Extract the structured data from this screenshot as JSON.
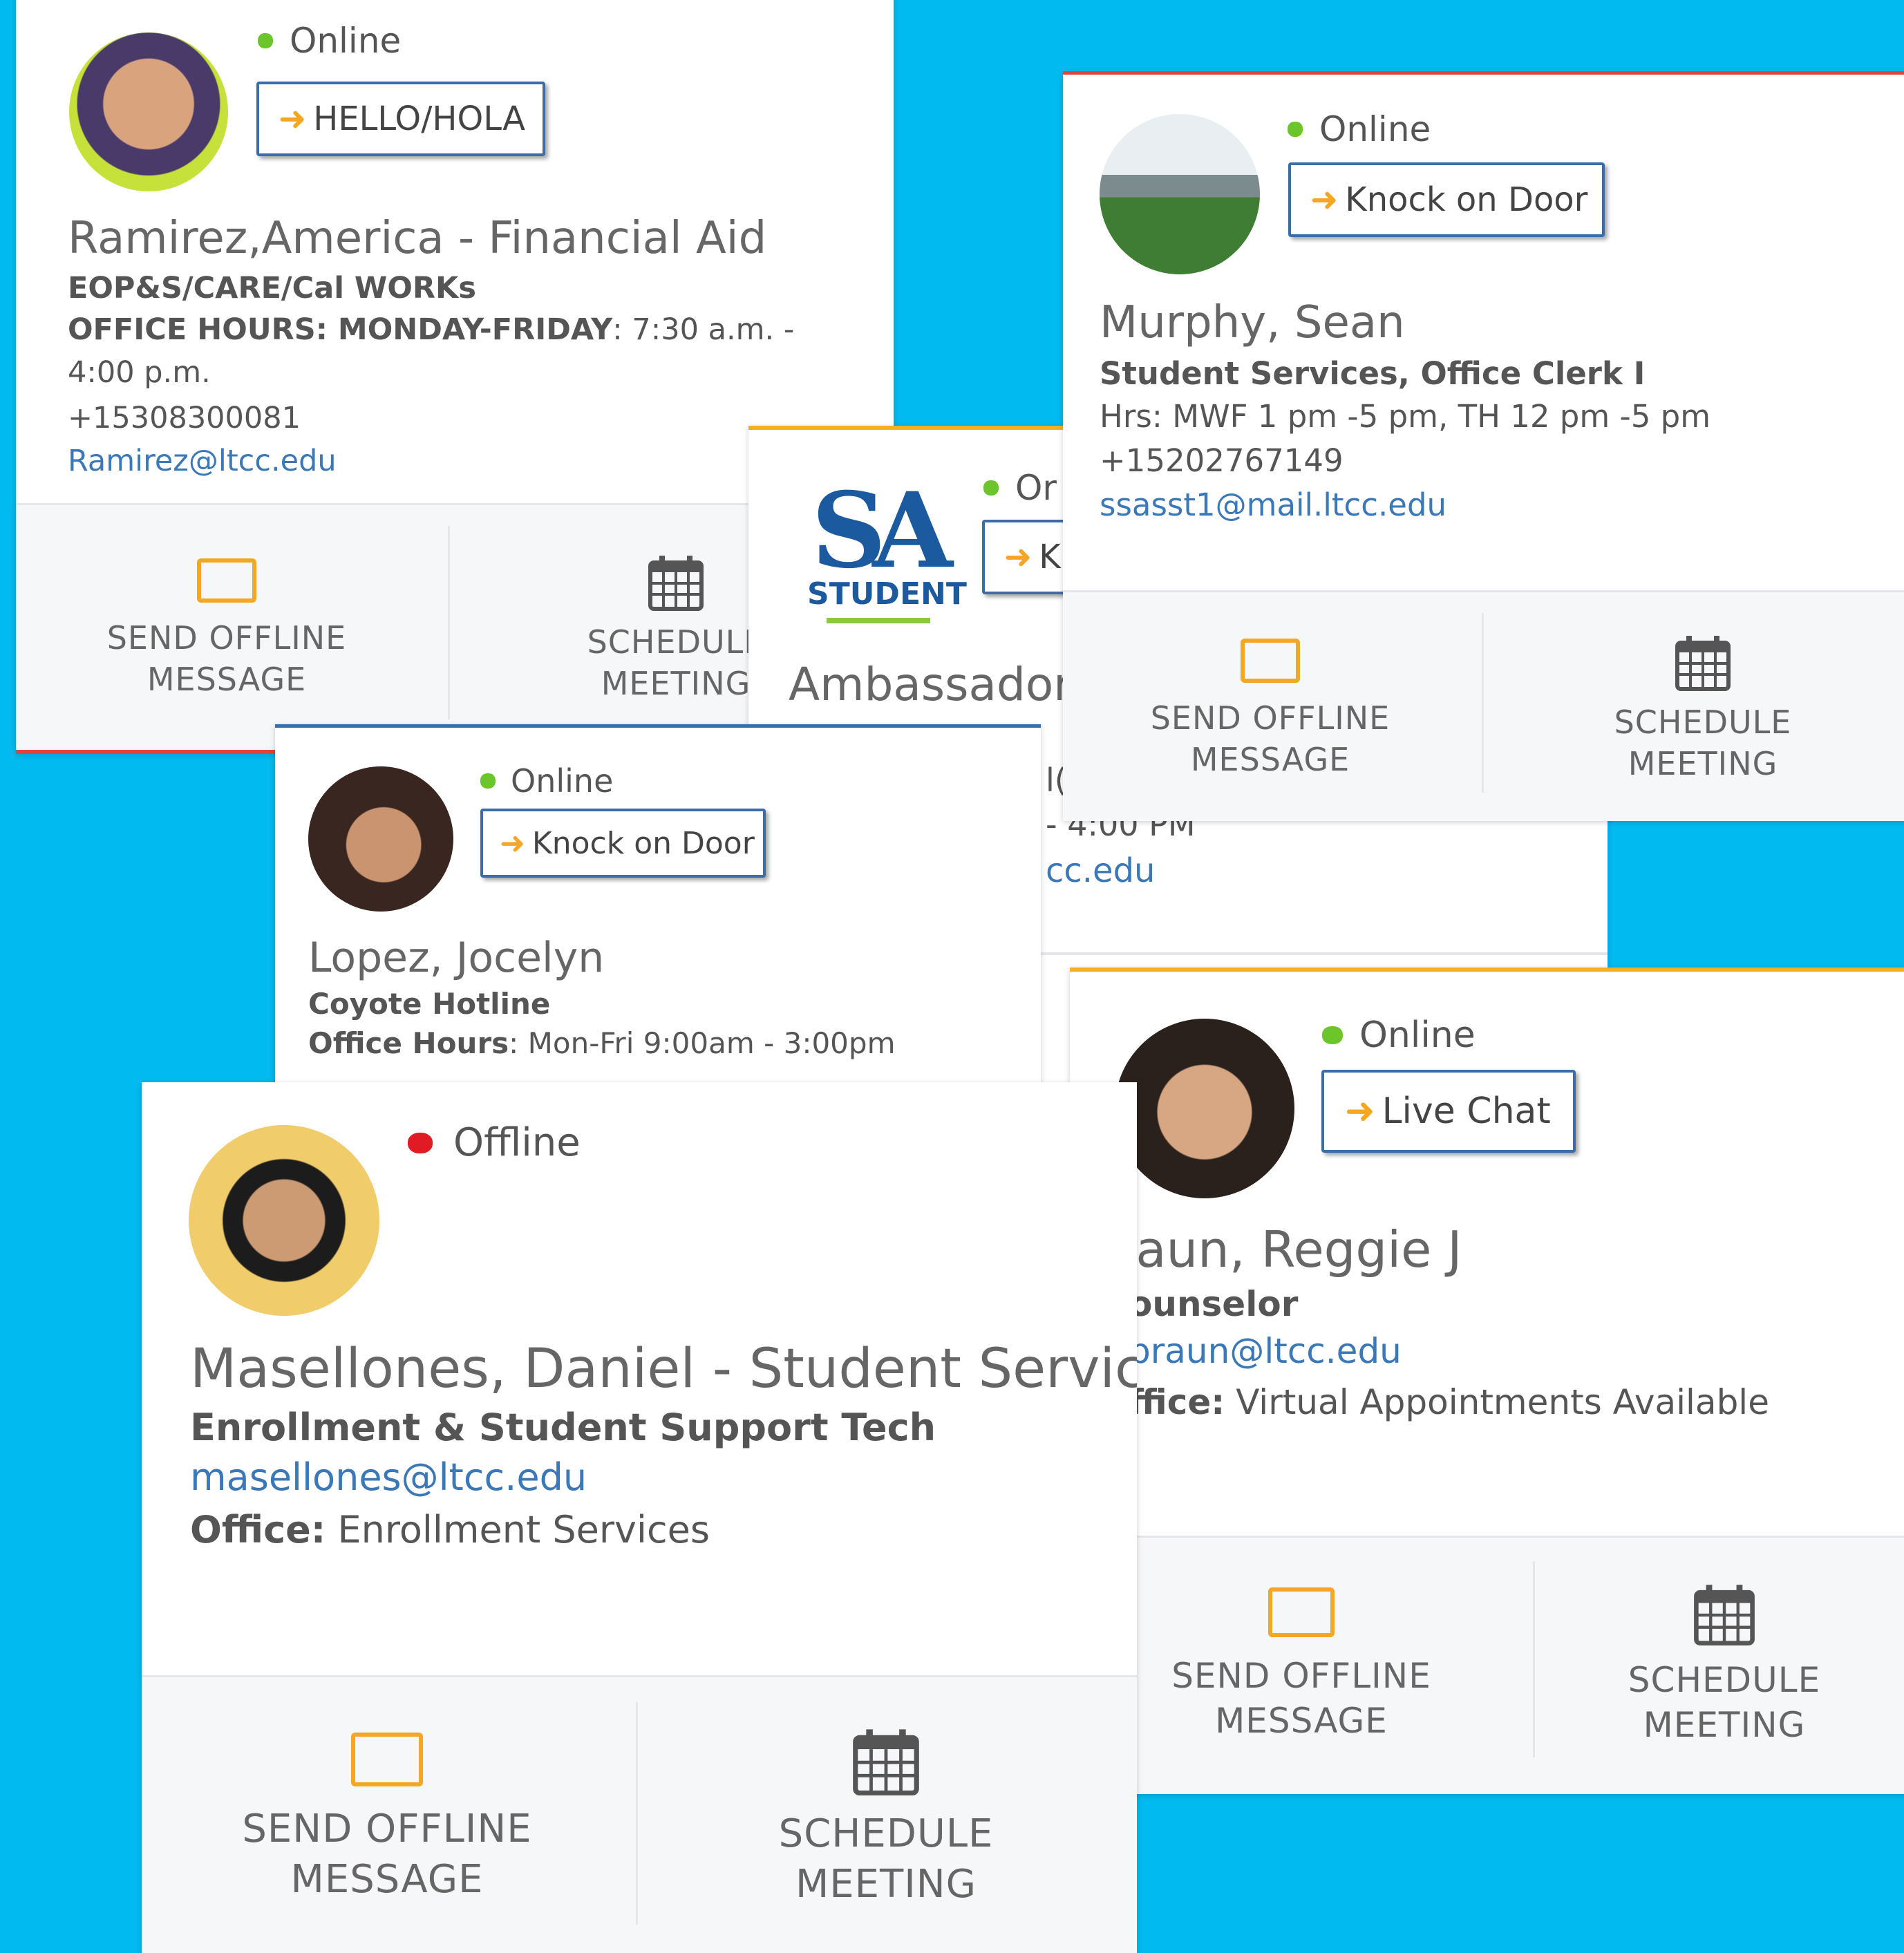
{
  "actions": {
    "send_offline_line1": "SEND OFFLINE",
    "send_offline_line2": "MESSAGE",
    "schedule_line1": "SCHEDULE",
    "schedule_line2": "MEETING"
  },
  "colors": {
    "background": "#00baf0",
    "online": "#6bc52b",
    "offline": "#e01b24",
    "accent_icon": "#f5a623",
    "link": "#3a78b8",
    "button_border": "#3c6da8"
  },
  "icons": {
    "status_online": "green-dot-icon",
    "status_offline": "red-dot-icon",
    "knock": "enter-arrow-icon",
    "message": "envelope-icon",
    "meeting": "calendar-icon"
  },
  "cards": {
    "ramirez": {
      "status": "Online",
      "button": "HELLO/HOLA",
      "name": "Ramirez,America - Financial Aid",
      "dept": "EOP&S/CARE/Cal WORKs",
      "hours_label": "OFFICE HOURS: MONDAY-FRIDAY",
      "hours_value": ": 7:30 a.m. -",
      "hours_value2": "4:00 p.m.",
      "phone": "+15308300081",
      "email": "Ramirez@ltcc.edu"
    },
    "ambassador": {
      "status": "Or",
      "button": "K",
      "logo_line1": "SA",
      "logo_line2": "STUDENT",
      "name": "Ambassador,",
      "fragment_hours": "- 4:00 PM",
      "fragment_email": "cc.edu",
      "fragment_mid": "l("
    },
    "murphy": {
      "status": "Online",
      "button": "Knock on Door",
      "name": "Murphy, Sean",
      "title": "Student Services, Office Clerk I",
      "hours": "Hrs: MWF 1 pm -5 pm, TH 12 pm -5 pm",
      "phone": "+15202767149",
      "email": "ssasst1@mail.ltcc.edu"
    },
    "lopez": {
      "status": "Online",
      "button": "Knock on Door",
      "name": "Lopez, Jocelyn",
      "title": "Coyote Hotline",
      "hours_label": "Office Hours",
      "hours_value": ": Mon-Fri 9:00am - 3:00pm"
    },
    "braun": {
      "status": "Online",
      "button": "Live Chat",
      "name": "3raun, Reggie J",
      "title": "ounselor",
      "email": "braun@ltcc.edu",
      "office_label": "ffice:",
      "office_value": " Virtual Appointments Available"
    },
    "masellones": {
      "status": "Offline",
      "name": "Masellones, Daniel - Student Services",
      "title": "Enrollment & Student Support Tech",
      "email": "masellones@ltcc.edu",
      "office_label": "Office:",
      "office_value": " Enrollment Services"
    }
  }
}
